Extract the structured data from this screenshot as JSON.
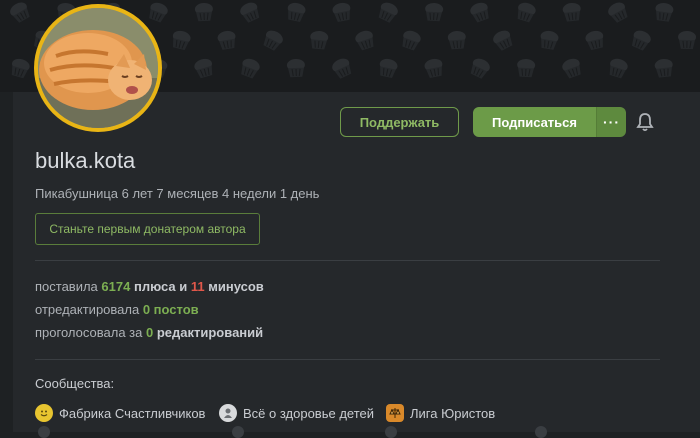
{
  "profile": {
    "username": "bulka.kota",
    "since": "Пикабушница 6 лет 7 месяцев 4 недели 1 день",
    "avatar_icon": "cat-photo-avatar",
    "accent_color": "#e9b515"
  },
  "actions": {
    "support_label": "Поддержать",
    "subscribe_label": "Подписаться",
    "more_label": "···",
    "donate_label": "Станьте первым донатером автора"
  },
  "stats": {
    "s1_prefix": "поставила",
    "s1_plus": "6174",
    "s1_mid": "плюса и",
    "s1_minus": "11",
    "s1_suffix": "минусов",
    "s2_prefix": "отредактировала",
    "s2_value": "0 постов",
    "s3_prefix": "проголосовала за",
    "s3_value": "0",
    "s3_suffix": "редактирований"
  },
  "communities": {
    "title": "Сообщества:",
    "items": [
      {
        "label": "Фабрика Счастливчиков",
        "icon": "smiley-icon"
      },
      {
        "label": "Всё о здоровье детей",
        "icon": "baby-icon"
      },
      {
        "label": "Лига Юристов",
        "icon": "scales-icon"
      }
    ]
  },
  "colors": {
    "green": "#6c9b48",
    "red": "#e0574a",
    "background": "#1e2123"
  }
}
